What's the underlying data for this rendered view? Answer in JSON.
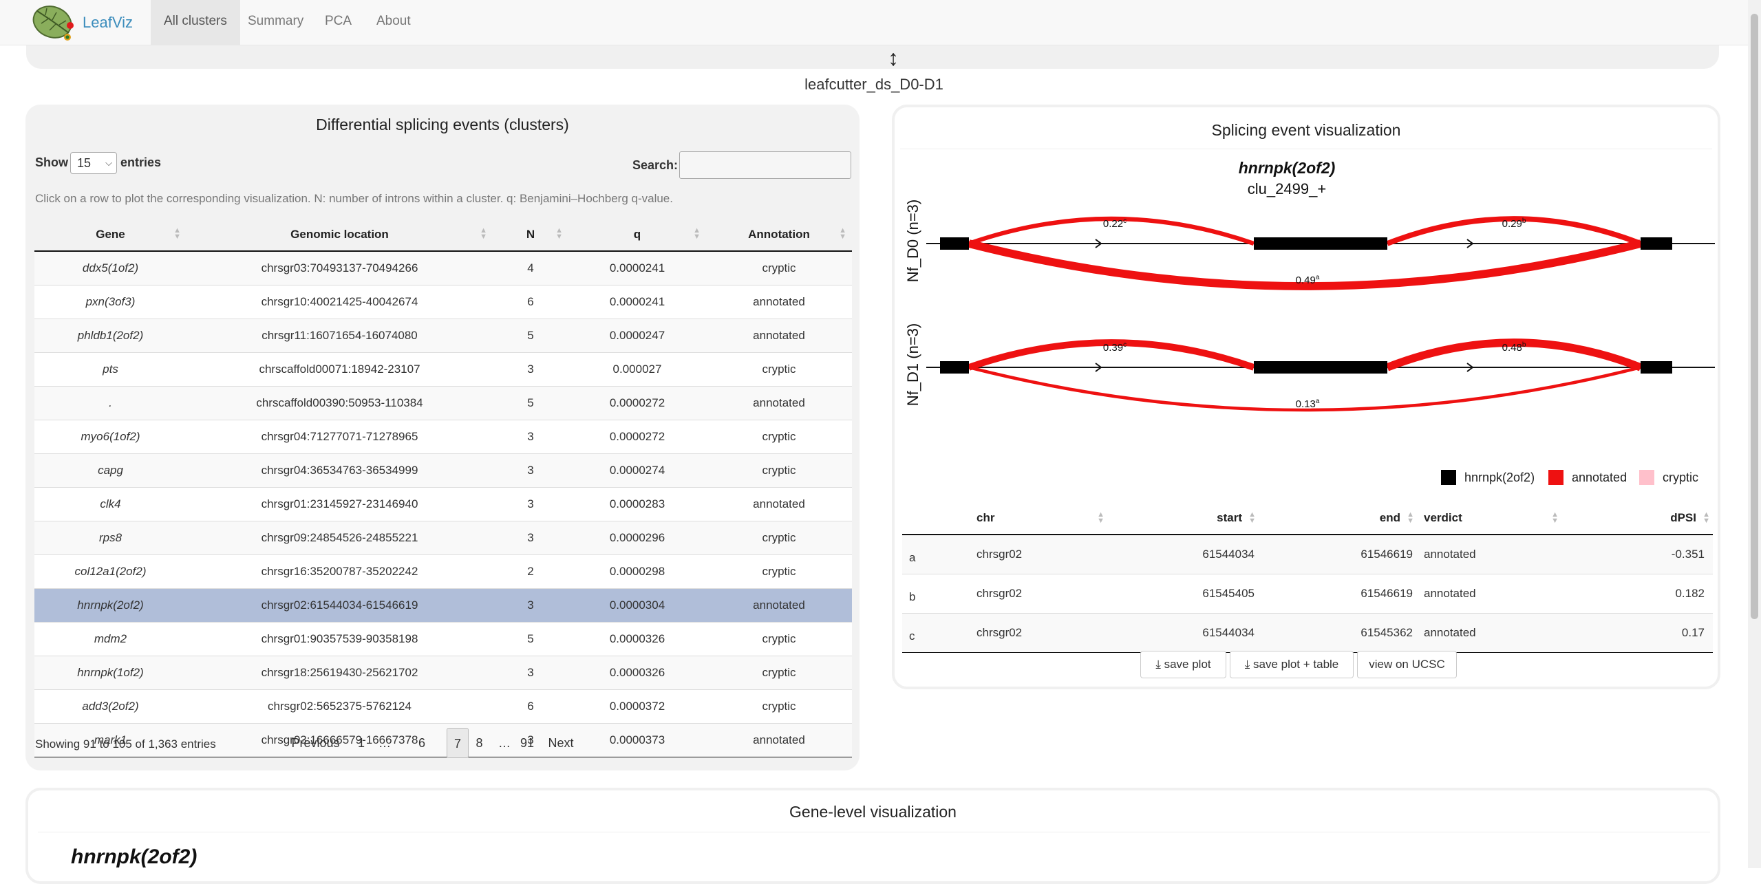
{
  "nav": {
    "brand": "LeafViz",
    "items": [
      "All clusters",
      "Summary",
      "PCA",
      "About"
    ]
  },
  "page_title": "leafcutter_ds_D0-D1",
  "clusters": {
    "title": "Differential splicing events (clusters)",
    "show_label": "Show",
    "show_value": "15",
    "entries_label": "entries",
    "search_label": "Search:",
    "search_value": "",
    "help": "Click on a row to plot the corresponding visualization. N: number of introns within a cluster. q: Benjamini–Hochberg q-value.",
    "columns": [
      "Gene",
      "Genomic location",
      "N",
      "q",
      "Annotation"
    ],
    "rows": [
      {
        "gene": "ddx5(1of2)",
        "location": "chrsgr03:70493137-70494266",
        "n": "4",
        "q": "0.0000241",
        "annotation": "cryptic"
      },
      {
        "gene": "pxn(3of3)",
        "location": "chrsgr10:40021425-40042674",
        "n": "6",
        "q": "0.0000241",
        "annotation": "annotated"
      },
      {
        "gene": "phldb1(2of2)",
        "location": "chrsgr11:16071654-16074080",
        "n": "5",
        "q": "0.0000247",
        "annotation": "annotated"
      },
      {
        "gene": "pts",
        "location": "chrscaffold00071:18942-23107",
        "n": "3",
        "q": "0.000027",
        "annotation": "cryptic"
      },
      {
        "gene": ".",
        "location": "chrscaffold00390:50953-110384",
        "n": "5",
        "q": "0.0000272",
        "annotation": "annotated"
      },
      {
        "gene": "myo6(1of2)",
        "location": "chrsgr04:71277071-71278965",
        "n": "3",
        "q": "0.0000272",
        "annotation": "cryptic"
      },
      {
        "gene": "capg",
        "location": "chrsgr04:36534763-36534999",
        "n": "3",
        "q": "0.0000274",
        "annotation": "cryptic"
      },
      {
        "gene": "clk4",
        "location": "chrsgr01:23145927-23146940",
        "n": "3",
        "q": "0.0000283",
        "annotation": "annotated"
      },
      {
        "gene": "rps8",
        "location": "chrsgr09:24854526-24855221",
        "n": "3",
        "q": "0.0000296",
        "annotation": "cryptic"
      },
      {
        "gene": "col12a1(2of2)",
        "location": "chrsgr16:35200787-35202242",
        "n": "2",
        "q": "0.0000298",
        "annotation": "cryptic"
      },
      {
        "gene": "hnrnpk(2of2)",
        "location": "chrsgr02:61544034-61546619",
        "n": "3",
        "q": "0.0000304",
        "annotation": "annotated"
      },
      {
        "gene": "mdm2",
        "location": "chrsgr01:90357539-90358198",
        "n": "5",
        "q": "0.0000326",
        "annotation": "cryptic"
      },
      {
        "gene": "hnrnpk(1of2)",
        "location": "chrsgr18:25619430-25621702",
        "n": "3",
        "q": "0.0000326",
        "annotation": "cryptic"
      },
      {
        "gene": "add3(2of2)",
        "location": "chrsgr02:5652375-5762124",
        "n": "6",
        "q": "0.0000372",
        "annotation": "cryptic"
      },
      {
        "gene": "mark1",
        "location": "chrsgr03:16666579-16667378",
        "n": "3",
        "q": "0.0000373",
        "annotation": "annotated"
      }
    ],
    "selected_row": 10,
    "info": "Showing 91 to 105 of 1,363 entries",
    "pagination": [
      "Previous",
      "1",
      "…",
      "6",
      "7",
      "8",
      "…",
      "91",
      "Next"
    ],
    "current_page": "7"
  },
  "splicing": {
    "title": "Splicing event visualization",
    "gene": "hnrnpk(2of2)",
    "cluster": "clu_2499_+",
    "tracks": [
      {
        "label": "Nf_D0 (n=3)",
        "arcs": [
          {
            "value": "0.22",
            "sup": "c"
          },
          {
            "value": "0.29",
            "sup": "b"
          },
          {
            "value": "0.49",
            "sup": "a"
          }
        ]
      },
      {
        "label": "Nf_D1 (n=3)",
        "arcs": [
          {
            "value": "0.39",
            "sup": "c"
          },
          {
            "value": "0.48",
            "sup": "b"
          },
          {
            "value": "0.13",
            "sup": "a"
          }
        ]
      }
    ],
    "legend": [
      {
        "label": "hnrnpk(2of2)",
        "color": "#000000"
      },
      {
        "label": "annotated",
        "color": "#ee1111"
      },
      {
        "label": "cryptic",
        "color": "#ffc0cb"
      }
    ],
    "table": {
      "columns": [
        "",
        "chr",
        "start",
        "end",
        "verdict",
        "dPSI"
      ],
      "rows": [
        {
          "id": "a",
          "chr": "chrsgr02",
          "start": "61544034",
          "end": "61546619",
          "verdict": "annotated",
          "dpsi": "-0.351"
        },
        {
          "id": "b",
          "chr": "chrsgr02",
          "start": "61545405",
          "end": "61546619",
          "verdict": "annotated",
          "dpsi": "0.182"
        },
        {
          "id": "c",
          "chr": "chrsgr02",
          "start": "61544034",
          "end": "61545362",
          "verdict": "annotated",
          "dpsi": "0.17"
        }
      ]
    },
    "buttons": [
      "save plot",
      "save plot + table",
      "view on UCSC"
    ]
  },
  "gene_level": {
    "title": "Gene-level visualization",
    "gene": "hnrnpk(2of2)"
  },
  "colors": {
    "arc_red": "#ee1111",
    "selected_row": "#b0bed9",
    "brand_blue": "#3c8dbc"
  }
}
